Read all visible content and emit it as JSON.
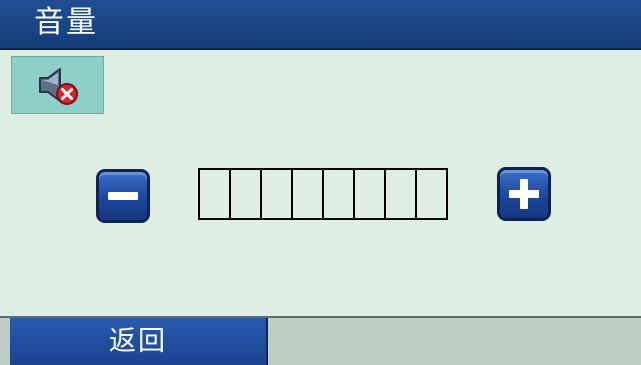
{
  "header": {
    "title": "音量"
  },
  "status": {
    "icon": "speaker-muted-icon"
  },
  "volume": {
    "level": 0,
    "segments": 8,
    "decrease_icon": "minus-icon",
    "increase_icon": "plus-icon"
  },
  "footer": {
    "back_label": "返回"
  },
  "colors": {
    "title_bar": "#1f4f92",
    "background": "#dfeee4",
    "button": "#1b449a",
    "status_box": "#8fcfc9",
    "footer_bar": "#bfcdc4"
  }
}
